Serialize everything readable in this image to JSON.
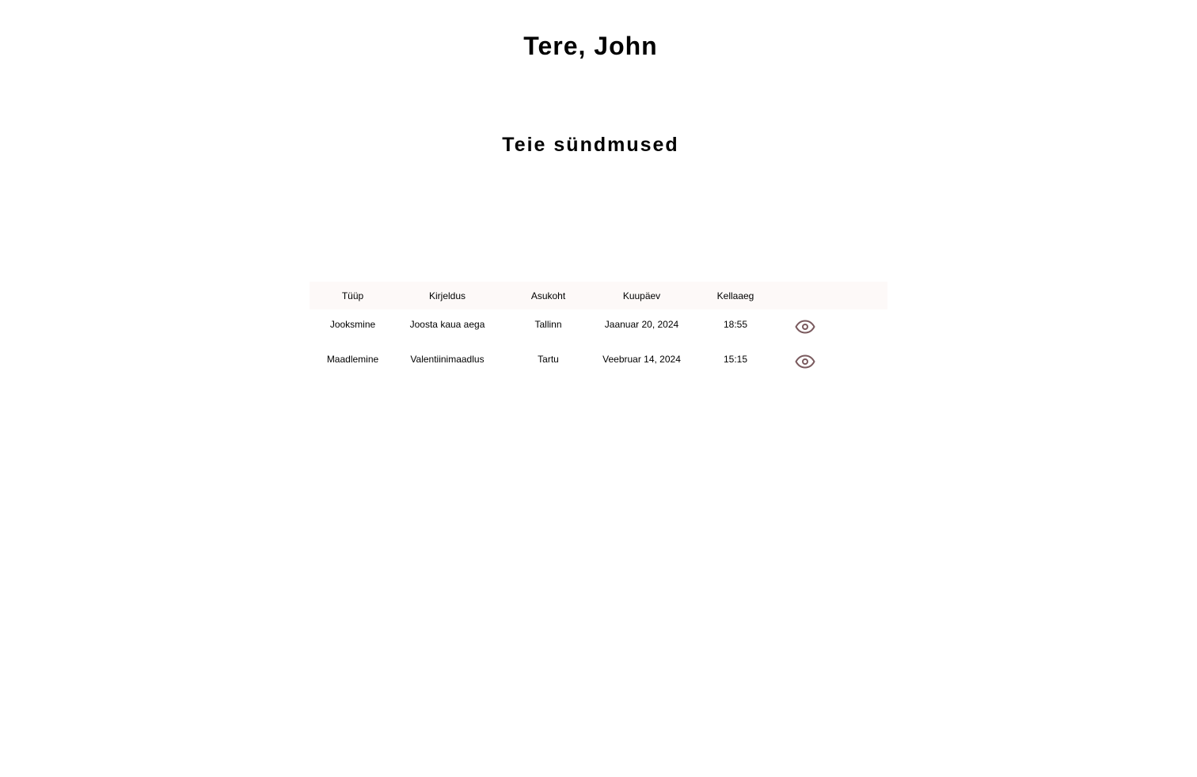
{
  "header": {
    "greeting": "Tere, John"
  },
  "events_section": {
    "title": "Teie sündmused"
  },
  "table": {
    "columns": [
      "Tüüp",
      "Kirjeldus",
      "Asukoht",
      "Kuupäev",
      "Kellaaeg"
    ],
    "rows": [
      {
        "type": "Jooksmine",
        "description": "Joosta kaua aega",
        "location": "Tallinn",
        "date": "Jaanuar 20, 2024",
        "time": "18:55",
        "action_icon": "eye-icon"
      },
      {
        "type": "Maadlemine",
        "description": "Valentiinimaadlus",
        "location": "Tartu",
        "date": "Veebruar 14, 2024",
        "time": "15:15",
        "action_icon": "eye-icon"
      }
    ]
  },
  "colors": {
    "text": "#000000",
    "header_row_bg": "#fdf9f8",
    "icon": "#7a5a5e"
  }
}
